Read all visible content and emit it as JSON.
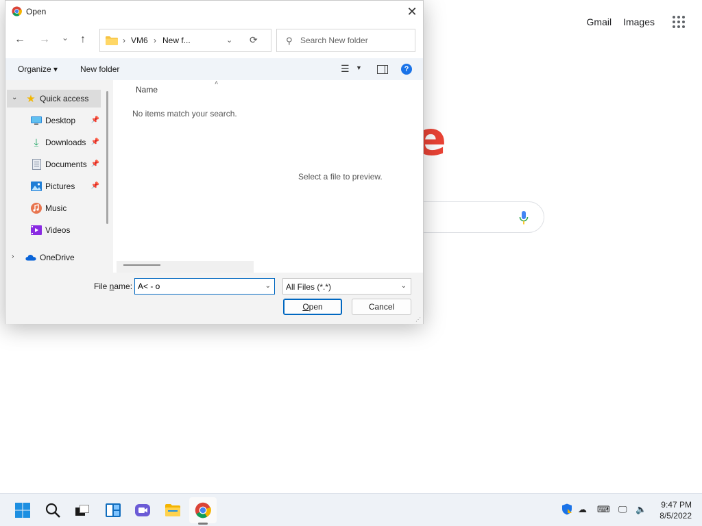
{
  "background": {
    "links": [
      "Gmail",
      "Images"
    ],
    "logo_letter": "e",
    "colors": {
      "logo_red": "#ea4335",
      "mic_blue": "#4285f4"
    }
  },
  "dialog": {
    "title": "Open",
    "close_glyph": "✕",
    "nav": {
      "back": "←",
      "forward": "→",
      "recent": "⌄",
      "up": "↑"
    },
    "address": {
      "crumbs": [
        "VM6",
        "New f..."
      ],
      "separator": "›",
      "dropdown": "⌄",
      "refresh": "⟳"
    },
    "search": {
      "placeholder": "Search New folder",
      "value": ""
    },
    "commands": {
      "organize": "Organize ▾",
      "new_folder": "New folder",
      "help": "?"
    },
    "nav_pane": {
      "quick_access": "Quick access",
      "items": [
        {
          "label": "Desktop",
          "pinned": true
        },
        {
          "label": "Downloads",
          "pinned": true
        },
        {
          "label": "Documents",
          "pinned": true
        },
        {
          "label": "Pictures",
          "pinned": true
        },
        {
          "label": "Music",
          "pinned": false
        },
        {
          "label": "Videos",
          "pinned": false
        }
      ],
      "onedrive": "OneDrive"
    },
    "content": {
      "column_name": "Name",
      "empty_message": "No items match your search.",
      "preview_message": "Select a file to preview."
    },
    "footer": {
      "file_name_label_prefix": "File ",
      "file_name_label_accel": "n",
      "file_name_label_suffix": "ame:",
      "file_name_value": "A< - o",
      "file_type": "All Files (*.*)",
      "open_accel": "O",
      "open_rest": "pen",
      "cancel": "Cancel"
    }
  },
  "taskbar": {
    "time": "9:47 PM",
    "date": "8/5/2022"
  }
}
